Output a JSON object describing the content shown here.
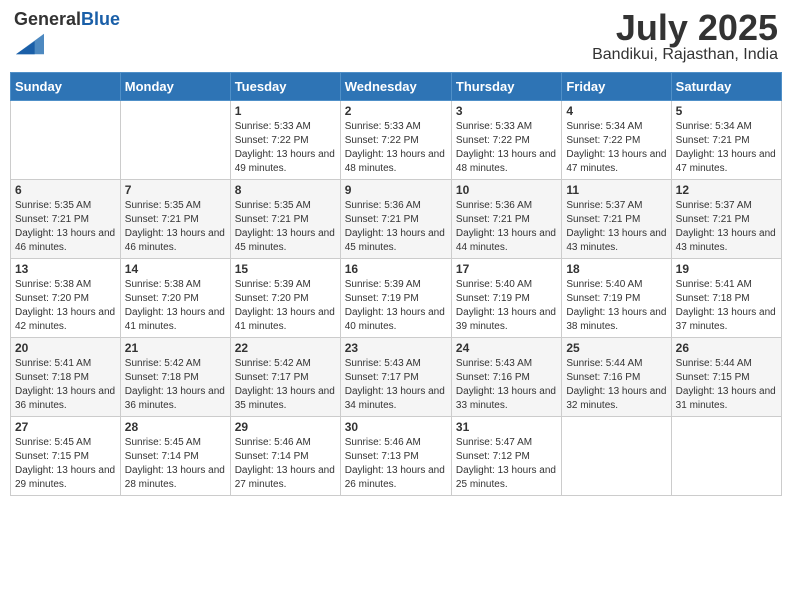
{
  "header": {
    "logo_general": "General",
    "logo_blue": "Blue",
    "month": "July 2025",
    "location": "Bandikui, Rajasthan, India"
  },
  "columns": [
    "Sunday",
    "Monday",
    "Tuesday",
    "Wednesday",
    "Thursday",
    "Friday",
    "Saturday"
  ],
  "weeks": [
    {
      "row_alt": false,
      "days": [
        {
          "num": "",
          "info": ""
        },
        {
          "num": "",
          "info": ""
        },
        {
          "num": "1",
          "info": "Sunrise: 5:33 AM\nSunset: 7:22 PM\nDaylight: 13 hours and 49 minutes."
        },
        {
          "num": "2",
          "info": "Sunrise: 5:33 AM\nSunset: 7:22 PM\nDaylight: 13 hours and 48 minutes."
        },
        {
          "num": "3",
          "info": "Sunrise: 5:33 AM\nSunset: 7:22 PM\nDaylight: 13 hours and 48 minutes."
        },
        {
          "num": "4",
          "info": "Sunrise: 5:34 AM\nSunset: 7:22 PM\nDaylight: 13 hours and 47 minutes."
        },
        {
          "num": "5",
          "info": "Sunrise: 5:34 AM\nSunset: 7:21 PM\nDaylight: 13 hours and 47 minutes."
        }
      ]
    },
    {
      "row_alt": true,
      "days": [
        {
          "num": "6",
          "info": "Sunrise: 5:35 AM\nSunset: 7:21 PM\nDaylight: 13 hours and 46 minutes."
        },
        {
          "num": "7",
          "info": "Sunrise: 5:35 AM\nSunset: 7:21 PM\nDaylight: 13 hours and 46 minutes."
        },
        {
          "num": "8",
          "info": "Sunrise: 5:35 AM\nSunset: 7:21 PM\nDaylight: 13 hours and 45 minutes."
        },
        {
          "num": "9",
          "info": "Sunrise: 5:36 AM\nSunset: 7:21 PM\nDaylight: 13 hours and 45 minutes."
        },
        {
          "num": "10",
          "info": "Sunrise: 5:36 AM\nSunset: 7:21 PM\nDaylight: 13 hours and 44 minutes."
        },
        {
          "num": "11",
          "info": "Sunrise: 5:37 AM\nSunset: 7:21 PM\nDaylight: 13 hours and 43 minutes."
        },
        {
          "num": "12",
          "info": "Sunrise: 5:37 AM\nSunset: 7:21 PM\nDaylight: 13 hours and 43 minutes."
        }
      ]
    },
    {
      "row_alt": false,
      "days": [
        {
          "num": "13",
          "info": "Sunrise: 5:38 AM\nSunset: 7:20 PM\nDaylight: 13 hours and 42 minutes."
        },
        {
          "num": "14",
          "info": "Sunrise: 5:38 AM\nSunset: 7:20 PM\nDaylight: 13 hours and 41 minutes."
        },
        {
          "num": "15",
          "info": "Sunrise: 5:39 AM\nSunset: 7:20 PM\nDaylight: 13 hours and 41 minutes."
        },
        {
          "num": "16",
          "info": "Sunrise: 5:39 AM\nSunset: 7:19 PM\nDaylight: 13 hours and 40 minutes."
        },
        {
          "num": "17",
          "info": "Sunrise: 5:40 AM\nSunset: 7:19 PM\nDaylight: 13 hours and 39 minutes."
        },
        {
          "num": "18",
          "info": "Sunrise: 5:40 AM\nSunset: 7:19 PM\nDaylight: 13 hours and 38 minutes."
        },
        {
          "num": "19",
          "info": "Sunrise: 5:41 AM\nSunset: 7:18 PM\nDaylight: 13 hours and 37 minutes."
        }
      ]
    },
    {
      "row_alt": true,
      "days": [
        {
          "num": "20",
          "info": "Sunrise: 5:41 AM\nSunset: 7:18 PM\nDaylight: 13 hours and 36 minutes."
        },
        {
          "num": "21",
          "info": "Sunrise: 5:42 AM\nSunset: 7:18 PM\nDaylight: 13 hours and 36 minutes."
        },
        {
          "num": "22",
          "info": "Sunrise: 5:42 AM\nSunset: 7:17 PM\nDaylight: 13 hours and 35 minutes."
        },
        {
          "num": "23",
          "info": "Sunrise: 5:43 AM\nSunset: 7:17 PM\nDaylight: 13 hours and 34 minutes."
        },
        {
          "num": "24",
          "info": "Sunrise: 5:43 AM\nSunset: 7:16 PM\nDaylight: 13 hours and 33 minutes."
        },
        {
          "num": "25",
          "info": "Sunrise: 5:44 AM\nSunset: 7:16 PM\nDaylight: 13 hours and 32 minutes."
        },
        {
          "num": "26",
          "info": "Sunrise: 5:44 AM\nSunset: 7:15 PM\nDaylight: 13 hours and 31 minutes."
        }
      ]
    },
    {
      "row_alt": false,
      "days": [
        {
          "num": "27",
          "info": "Sunrise: 5:45 AM\nSunset: 7:15 PM\nDaylight: 13 hours and 29 minutes."
        },
        {
          "num": "28",
          "info": "Sunrise: 5:45 AM\nSunset: 7:14 PM\nDaylight: 13 hours and 28 minutes."
        },
        {
          "num": "29",
          "info": "Sunrise: 5:46 AM\nSunset: 7:14 PM\nDaylight: 13 hours and 27 minutes."
        },
        {
          "num": "30",
          "info": "Sunrise: 5:46 AM\nSunset: 7:13 PM\nDaylight: 13 hours and 26 minutes."
        },
        {
          "num": "31",
          "info": "Sunrise: 5:47 AM\nSunset: 7:12 PM\nDaylight: 13 hours and 25 minutes."
        },
        {
          "num": "",
          "info": ""
        },
        {
          "num": "",
          "info": ""
        }
      ]
    }
  ]
}
